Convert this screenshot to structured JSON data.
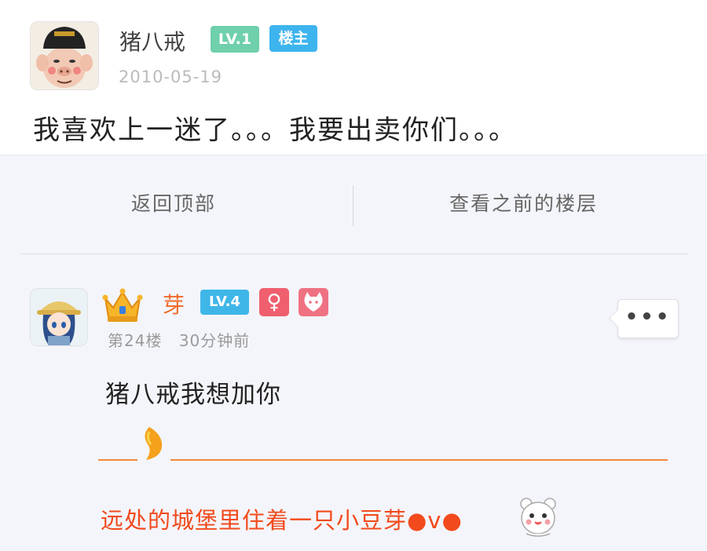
{
  "op_post": {
    "username": "猪八戒",
    "level": "LV.1",
    "tag": "楼主",
    "date": "2010-05-19",
    "content": "我喜欢上一迷了。。。我要出卖你们。。。"
  },
  "nav": {
    "back_to_top": "返回顶部",
    "view_previous": "查看之前的楼层"
  },
  "reply": {
    "username": "芽",
    "level": "LV.4",
    "gender": "♀",
    "floor": "第24楼",
    "time": "30分钟前",
    "more_label": "•••",
    "content": "猪八戒我想加你",
    "signature": "远处的城堡里住着一只小豆芽●v●"
  },
  "colors": {
    "accent_orange": "#f26b2b",
    "signature_red": "#f24a1c",
    "level_green": "#6fd0ab",
    "level_blue": "#3fb6e8",
    "tag_blue": "#3db4ee",
    "gender_pink": "#ef5f6e"
  },
  "icons": {
    "crown": "crown-icon",
    "sprout": "sprout-icon",
    "medal": "cat-medal-icon",
    "emoji": "bear-face-icon"
  }
}
